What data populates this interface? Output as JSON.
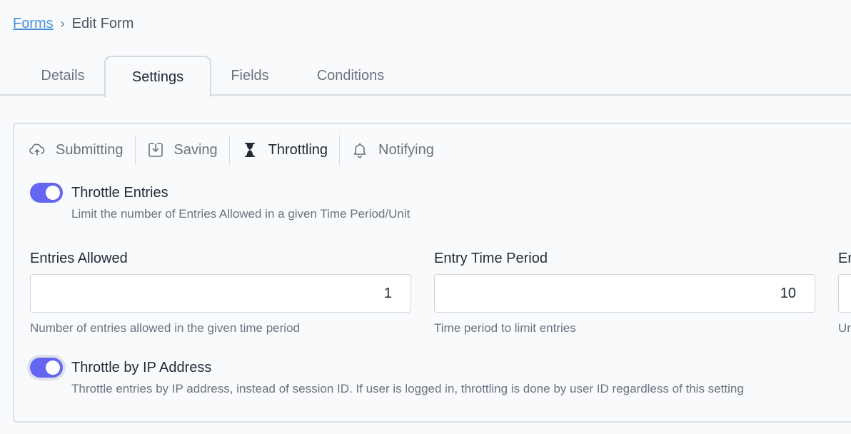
{
  "breadcrumb": {
    "link": "Forms",
    "separator": "›",
    "current": "Edit Form"
  },
  "tabs": [
    {
      "label": "Details"
    },
    {
      "label": "Settings"
    },
    {
      "label": "Fields"
    },
    {
      "label": "Conditions"
    }
  ],
  "subtabs": [
    {
      "label": "Submitting",
      "icon": "cloud-upload-icon"
    },
    {
      "label": "Saving",
      "icon": "download-box-icon"
    },
    {
      "label": "Throttling",
      "icon": "hourglass-icon"
    },
    {
      "label": "Notifying",
      "icon": "bell-icon"
    }
  ],
  "throttle_entries": {
    "enabled": true,
    "title": "Throttle Entries",
    "description": "Limit the number of Entries Allowed in a given Time Period/Unit"
  },
  "fields": [
    {
      "label": "Entries Allowed",
      "value": "1",
      "help": "Number of entries allowed in the given time period"
    },
    {
      "label": "Entry Time Period",
      "value": "10",
      "help": "Time period to limit entries"
    },
    {
      "label": "En",
      "value": "",
      "help": "Ur"
    }
  ],
  "throttle_ip": {
    "enabled": true,
    "title": "Throttle by IP Address",
    "description": "Throttle entries by IP address, instead of session ID. If user is logged in, throttling is done by user ID regardless of this setting"
  },
  "colors": {
    "accent": "#6366f1",
    "link": "#4a90d9",
    "border": "#d6dbe2"
  }
}
